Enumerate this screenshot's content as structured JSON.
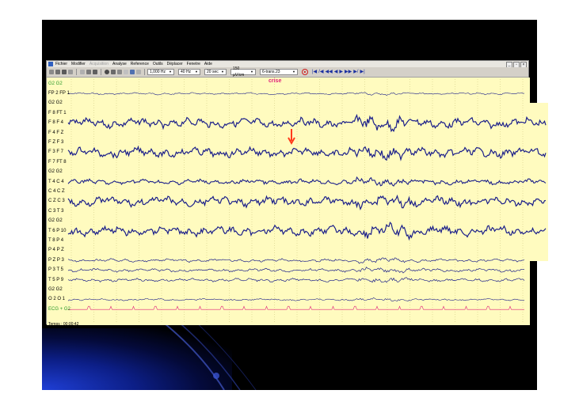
{
  "menu": {
    "items": [
      {
        "label": "Fichier",
        "disabled": false
      },
      {
        "label": "Modifier",
        "disabled": false
      },
      {
        "label": "Acquisition",
        "disabled": true
      },
      {
        "label": "Analyse",
        "disabled": false
      },
      {
        "label": "Reference",
        "disabled": false
      },
      {
        "label": "Outils",
        "disabled": false
      },
      {
        "label": "Déplacer",
        "disabled": false
      },
      {
        "label": "Fenetre",
        "disabled": false
      },
      {
        "label": "Aide",
        "disabled": false
      }
    ]
  },
  "toolbar": {
    "sampling": "1,000 Hz",
    "filter": "40 Hz",
    "timebase": "20 sec",
    "gain": "150 µV/cm",
    "montage": "6-trans.23"
  },
  "event_label": "crise",
  "channels": [
    {
      "label": "G2 G2",
      "kind": "ref"
    },
    {
      "label": "FP 2 FP 1",
      "kind": "flat"
    },
    {
      "label": "G2 G2",
      "kind": "ref"
    },
    {
      "label": "F 8 FT 1",
      "kind": "none"
    },
    {
      "label": "F 8 F 4",
      "kind": "big"
    },
    {
      "label": "F 4 F Z",
      "kind": "none"
    },
    {
      "label": "F Z F 3",
      "kind": "none"
    },
    {
      "label": "F 3 F 7",
      "kind": "big"
    },
    {
      "label": "F 7 FT 8",
      "kind": "none"
    },
    {
      "label": "G2 G2",
      "kind": "ref"
    },
    {
      "label": "T 4 C 4",
      "kind": "mid"
    },
    {
      "label": "C 4 C Z",
      "kind": "none"
    },
    {
      "label": "C Z C 3",
      "kind": "big"
    },
    {
      "label": "C 3 T 3",
      "kind": "none"
    },
    {
      "label": "G2 G2",
      "kind": "ref"
    },
    {
      "label": "T 6 P 10",
      "kind": "big"
    },
    {
      "label": "T 8 P 4",
      "kind": "none"
    },
    {
      "label": "P 4 P Z",
      "kind": "none"
    },
    {
      "label": "P Z P 3",
      "kind": "small"
    },
    {
      "label": "P 3 T 5",
      "kind": "small"
    },
    {
      "label": "T 5 P 9",
      "kind": "small"
    },
    {
      "label": "G2 G2",
      "kind": "ref"
    },
    {
      "label": "O 2 O 1",
      "kind": "flat"
    },
    {
      "label": "ECG + G2",
      "kind": "ecg"
    }
  ],
  "time_readout": "Temps : 00:00:42",
  "colors": {
    "trace": "#1b1f8a",
    "background": "#fffbbf",
    "ecg": "#e0207a",
    "arrow": "#ff3a1a",
    "label_green": "#2a9a2a"
  }
}
